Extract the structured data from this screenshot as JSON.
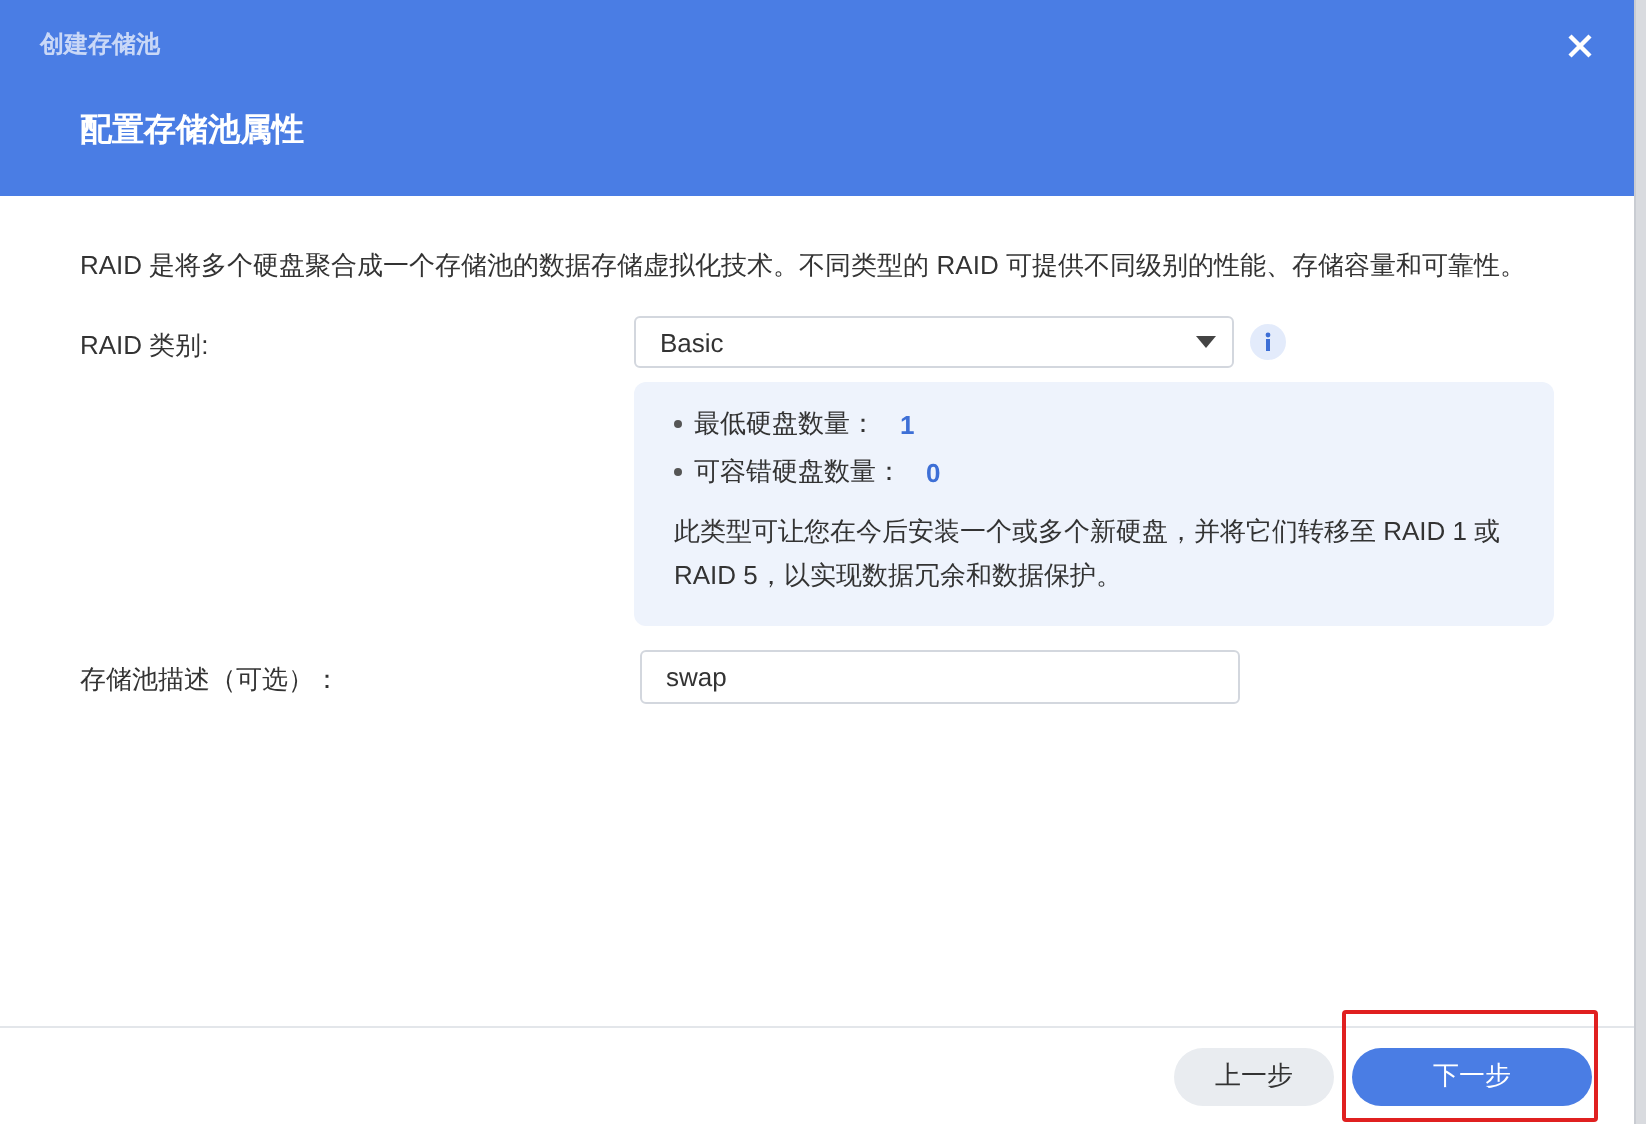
{
  "window": {
    "title": "创建存储池",
    "heading": "配置存储池属性"
  },
  "description": "RAID 是将多个硬盘聚合成一个存储池的数据存储虚拟化技术。不同类型的 RAID 可提供不同级别的性能、存储容量和可靠性。",
  "raid_type": {
    "label": "RAID 类别:",
    "value": "Basic"
  },
  "info": {
    "items": [
      {
        "label": "最低硬盘数量：",
        "value": "1"
      },
      {
        "label": "可容错硬盘数量：",
        "value": "0"
      }
    ],
    "note": "此类型可让您在今后安装一个或多个新硬盘，并将它们转移至 RAID 1 或 RAID 5，以实现数据冗余和数据保护。"
  },
  "pool_description": {
    "label": "存储池描述（可选）：",
    "value": "swap"
  },
  "buttons": [
    {
      "label": "上一步",
      "kind": "secondary",
      "highlighted": false
    },
    {
      "label": "下一步",
      "kind": "primary",
      "highlighted": true
    }
  ]
}
